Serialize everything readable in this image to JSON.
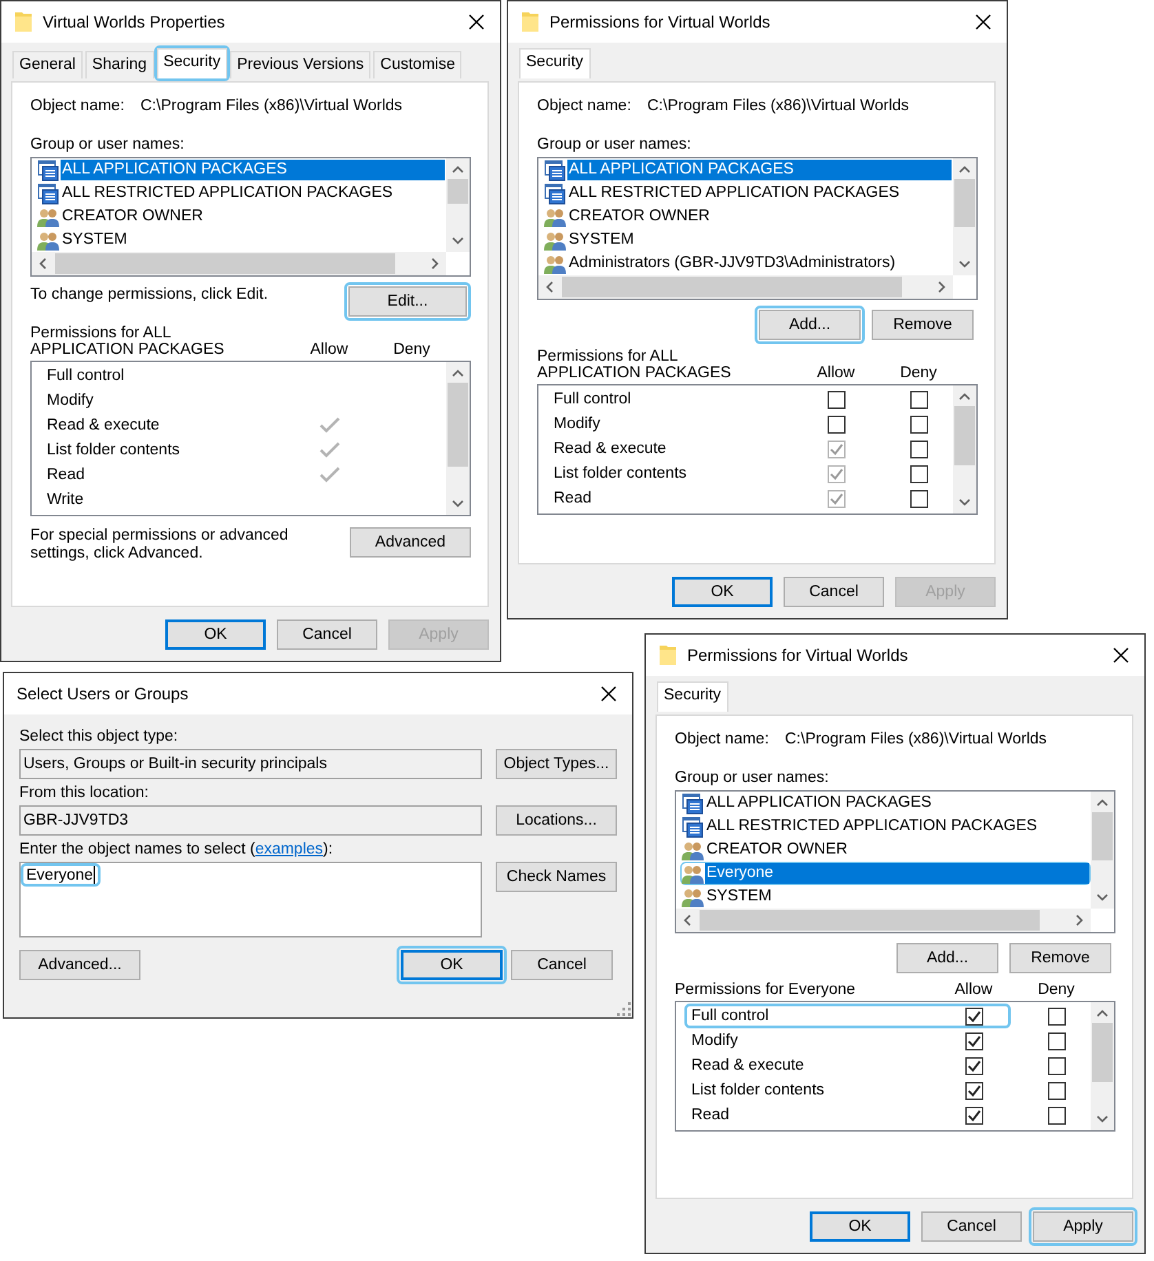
{
  "dialogs": [
    {
      "kind": "security",
      "title": "Virtual Worlds Properties",
      "tabs": [
        {
          "label": "General",
          "selected": false,
          "highlighted": false
        },
        {
          "label": "Sharing",
          "selected": false,
          "highlighted": false
        },
        {
          "label": "Security",
          "selected": true,
          "highlighted": true
        },
        {
          "label": "Previous Versions",
          "selected": false,
          "highlighted": false
        },
        {
          "label": "Customise",
          "selected": false,
          "highlighted": false
        }
      ],
      "object_label": "Object name:",
      "object_name": "C:\\Program Files (x86)\\Virtual Worlds",
      "names_label": "Group or user names:",
      "names": [
        {
          "kind": "package",
          "name": "ALL APPLICATION PACKAGES",
          "selected": true
        },
        {
          "kind": "package",
          "name": "ALL RESTRICTED APPLICATION PACKAGES",
          "selected": false
        },
        {
          "kind": "users",
          "name": "CREATOR OWNER",
          "selected": false
        },
        {
          "kind": "users",
          "name": "SYSTEM",
          "selected": false
        }
      ],
      "change_note": "To change permissions, click Edit.",
      "list_buttons": [
        {
          "label": "Edit...",
          "highlighted": true
        }
      ],
      "permissions_label": [
        "Permissions for ALL",
        "APPLICATION PACKAGES"
      ],
      "allow_label": "Allow",
      "deny_label": "Deny",
      "permissions": [
        {
          "kind": "tick",
          "name": "Full control",
          "allow": false,
          "deny": false
        },
        {
          "kind": "tick",
          "name": "Modify",
          "allow": false,
          "deny": false
        },
        {
          "kind": "tick",
          "name": "Read & execute",
          "allow": true,
          "deny": false
        },
        {
          "kind": "tick",
          "name": "List folder contents",
          "allow": true,
          "deny": false
        },
        {
          "kind": "tick",
          "name": "Read",
          "allow": true,
          "deny": false
        },
        {
          "kind": "tick",
          "name": "Write",
          "allow": false,
          "deny": false
        }
      ],
      "advanced_note": "For special permissions or advanced settings, click Advanced.",
      "advanced_button": "Advanced",
      "buttons": [
        {
          "label": "OK",
          "default": true,
          "disabled": false,
          "highlighted": false
        },
        {
          "label": "Cancel",
          "default": false,
          "disabled": false,
          "highlighted": false
        },
        {
          "label": "Apply",
          "default": false,
          "disabled": true,
          "highlighted": false
        }
      ]
    },
    {
      "kind": "security",
      "title": "Permissions for Virtual Worlds",
      "tabs": [
        {
          "label": "Security",
          "selected": true
        }
      ],
      "object_label": "Object name:",
      "object_name": "C:\\Program Files (x86)\\Virtual Worlds",
      "names_label": "Group or user names:",
      "names": [
        {
          "kind": "package",
          "name": "ALL APPLICATION PACKAGES",
          "selected": true
        },
        {
          "kind": "package",
          "name": "ALL RESTRICTED APPLICATION PACKAGES",
          "selected": false
        },
        {
          "kind": "users",
          "name": "CREATOR OWNER",
          "selected": false
        },
        {
          "kind": "users",
          "name": "SYSTEM",
          "selected": false
        },
        {
          "kind": "users",
          "name": "Administrators (GBR-JJV9TD3\\Administrators)",
          "selected": false
        }
      ],
      "list_buttons": [
        {
          "label": "Add...",
          "highlighted": true
        },
        {
          "label": "Remove",
          "highlighted": false
        }
      ],
      "permissions_label": [
        "Permissions for ALL",
        "APPLICATION PACKAGES"
      ],
      "allow_label": "Allow",
      "deny_label": "Deny",
      "permissions": [
        {
          "kind": "checkbox",
          "name": "Full control",
          "allow": false,
          "deny": false,
          "disabled": false
        },
        {
          "kind": "checkbox",
          "name": "Modify",
          "allow": false,
          "deny": false,
          "disabled": false
        },
        {
          "kind": "checkbox",
          "name": "Read & execute",
          "allow": true,
          "deny": false,
          "disabled": true
        },
        {
          "kind": "checkbox",
          "name": "List folder contents",
          "allow": true,
          "deny": false,
          "disabled": true
        },
        {
          "kind": "checkbox",
          "name": "Read",
          "allow": true,
          "deny": false,
          "disabled": true
        }
      ],
      "buttons": [
        {
          "label": "OK",
          "default": true,
          "disabled": false
        },
        {
          "label": "Cancel",
          "default": false,
          "disabled": false
        },
        {
          "label": "Apply",
          "default": false,
          "disabled": true
        }
      ]
    },
    {
      "kind": "select",
      "title": "Select Users or Groups",
      "fields": [
        {
          "label": "Select this object type:",
          "value": "Users, Groups or Built-in security principals",
          "button": "Object Types..."
        },
        {
          "label": "From this location:",
          "value": "GBR-JJV9TD3",
          "button": "Locations..."
        }
      ],
      "names_prompt": {
        "before": "Enter the object names to select (",
        "link": "examples",
        "after": "):"
      },
      "names_value": "Everyone",
      "names_value_highlighted": true,
      "check_button": "Check Names",
      "advanced_button": "Advanced...",
      "buttons": [
        {
          "label": "OK",
          "default": true,
          "highlighted": true
        },
        {
          "label": "Cancel",
          "default": false,
          "highlighted": false
        }
      ]
    },
    {
      "kind": "security",
      "title": "Permissions for Virtual Worlds",
      "tabs": [
        {
          "label": "Security",
          "selected": true
        }
      ],
      "object_label": "Object name:",
      "object_name": "C:\\Program Files (x86)\\Virtual Worlds",
      "names_label": "Group or user names:",
      "names": [
        {
          "kind": "package",
          "name": "ALL APPLICATION PACKAGES",
          "selected": false,
          "highlighted": false
        },
        {
          "kind": "package",
          "name": "ALL RESTRICTED APPLICATION PACKAGES",
          "selected": false,
          "highlighted": false
        },
        {
          "kind": "users",
          "name": "CREATOR OWNER",
          "selected": false,
          "highlighted": false
        },
        {
          "kind": "users",
          "name": "Everyone",
          "selected": true,
          "highlighted": true
        },
        {
          "kind": "users",
          "name": "SYSTEM",
          "selected": false,
          "highlighted": false
        }
      ],
      "list_buttons": [
        {
          "label": "Add..."
        },
        {
          "label": "Remove"
        }
      ],
      "permissions_label": [
        "Permissions for Everyone"
      ],
      "allow_label": "Allow",
      "deny_label": "Deny",
      "permissions": [
        {
          "kind": "checkbox",
          "name": "Full control",
          "allow": true,
          "deny": false,
          "disabled": false,
          "highlighted": true
        },
        {
          "kind": "checkbox",
          "name": "Modify",
          "allow": true,
          "deny": false,
          "disabled": false,
          "highlighted": false
        },
        {
          "kind": "checkbox",
          "name": "Read & execute",
          "allow": true,
          "deny": false,
          "disabled": false,
          "highlighted": false
        },
        {
          "kind": "checkbox",
          "name": "List folder contents",
          "allow": true,
          "deny": false,
          "disabled": false,
          "highlighted": false
        },
        {
          "kind": "checkbox",
          "name": "Read",
          "allow": true,
          "deny": false,
          "disabled": false,
          "highlighted": false
        }
      ],
      "buttons": [
        {
          "label": "OK",
          "default": true,
          "disabled": false,
          "highlighted": false
        },
        {
          "label": "Cancel",
          "default": false,
          "disabled": false,
          "highlighted": false
        },
        {
          "label": "Apply",
          "default": false,
          "disabled": false,
          "highlighted": true
        }
      ]
    }
  ]
}
